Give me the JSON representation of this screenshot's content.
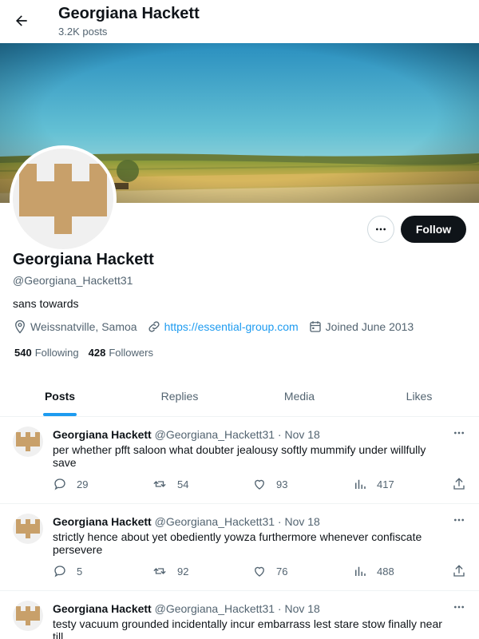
{
  "header": {
    "name": "Georgiana Hackett",
    "post_count": "3.2K posts"
  },
  "profile": {
    "name": "Georgiana Hackett",
    "handle": "@Georgiana_Hackett31",
    "bio": "sans towards",
    "location": "Weissnatville, Samoa",
    "website": "https://essential-group.com",
    "joined": "Joined June 2013",
    "following_count": "540",
    "following_label": "Following",
    "followers_count": "428",
    "followers_label": "Followers",
    "follow_button": "Follow",
    "avatar_color": "#c8a06a"
  },
  "tabs": [
    {
      "label": "Posts",
      "active": true
    },
    {
      "label": "Replies",
      "active": false
    },
    {
      "label": "Media",
      "active": false
    },
    {
      "label": "Likes",
      "active": false
    }
  ],
  "posts": [
    {
      "name": "Georgiana Hackett",
      "handle": "@Georgiana_Hackett31",
      "dot": "·",
      "date": "Nov 18",
      "text": "per whether pfft saloon what doubter jealousy softly mummify under willfully save",
      "replies": "29",
      "reposts": "54",
      "likes": "93",
      "views": "417"
    },
    {
      "name": "Georgiana Hackett",
      "handle": "@Georgiana_Hackett31",
      "dot": "·",
      "date": "Nov 18",
      "text": "strictly hence about yet obediently yowza furthermore whenever confiscate persevere",
      "replies": "5",
      "reposts": "92",
      "likes": "76",
      "views": "488"
    },
    {
      "name": "Georgiana Hackett",
      "handle": "@Georgiana_Hackett31",
      "dot": "·",
      "date": "Nov 18",
      "text": "testy vacuum grounded incidentally incur embarrass lest stare stow finally near till",
      "replies": "",
      "reposts": "",
      "likes": "",
      "views": ""
    }
  ],
  "colors": {
    "accent": "#1d9bf0",
    "text": "#0f1419",
    "muted": "#536471",
    "border": "#eff3f4"
  },
  "icons": [
    "back-arrow-icon",
    "more-dots-icon",
    "location-icon",
    "link-icon",
    "calendar-icon",
    "reply-icon",
    "repost-icon",
    "like-icon",
    "views-icon",
    "share-icon"
  ]
}
